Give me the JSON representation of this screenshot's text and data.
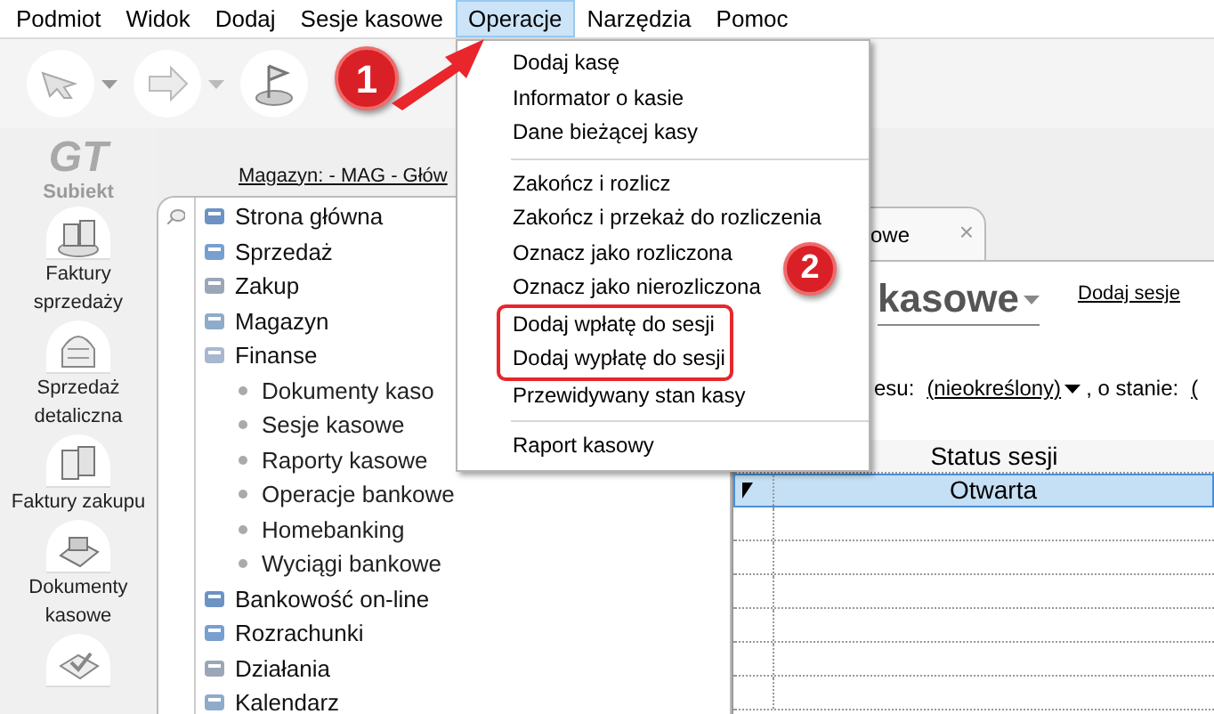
{
  "menu_bar": [
    {
      "label": "Podmiot",
      "selected": false
    },
    {
      "label": "Widok",
      "selected": false
    },
    {
      "label": "Dodaj",
      "selected": false
    },
    {
      "label": "Sesje kasowe",
      "selected": false
    },
    {
      "label": "Operacje",
      "selected": true
    },
    {
      "label": "Narzędzia",
      "selected": false
    },
    {
      "label": "Pomoc",
      "selected": false
    }
  ],
  "logo": {
    "mark": "GT",
    "name": "Subiekt"
  },
  "sidebar": {
    "items": [
      {
        "label": "Faktury sprzedaży"
      },
      {
        "label": "Sprzedaż detaliczna"
      },
      {
        "label": "Faktury zakupu"
      },
      {
        "label": "Dokumenty kasowe",
        "kind": "labelled"
      },
      {
        "kind": "icon_only"
      }
    ]
  },
  "warehouse_link": "Magazyn: - MAG - Głów",
  "tree": [
    {
      "label": "Strona główna"
    },
    {
      "label": "Sprzedaż"
    },
    {
      "label": "Zakup"
    },
    {
      "label": "Magazyn"
    },
    {
      "label": "Finanse",
      "children": [
        {
          "label": "Dokumenty kaso"
        },
        {
          "label": "Sesje kasowe"
        },
        {
          "label": "Raporty kasowe"
        },
        {
          "label": "Operacje bankowe"
        },
        {
          "label": "Homebanking"
        },
        {
          "label": "Wyciągi bankowe"
        }
      ]
    },
    {
      "label": "Bankowość on-line"
    },
    {
      "label": "Rozrachunki"
    },
    {
      "label": "Działania"
    },
    {
      "label": "Kalendarz"
    }
  ],
  "tab": {
    "label": "owe",
    "close": "×"
  },
  "view": {
    "title": "kasowe",
    "add_link": "Dodaj sesje",
    "filter_label": "esu:",
    "filter_value": "(nieokreślony)",
    "state_label": ", o stanie:",
    "state_value": "("
  },
  "table": {
    "columns": [
      "Status sesji"
    ],
    "rows": [
      {
        "cells": [
          "Otwarta"
        ],
        "selected": true
      }
    ]
  },
  "dropdown_menu": {
    "groups": [
      [
        {
          "label": "Dodaj kasę",
          "highlighted": false
        },
        {
          "label": "Informator o kasie",
          "highlighted": false
        },
        {
          "label": "Dane bieżącej kasy",
          "highlighted": false
        }
      ],
      [
        {
          "label": "Zakończ i rozlicz",
          "highlighted": false
        },
        {
          "label": "Zakończ i przekaż do rozliczenia",
          "highlighted": false
        },
        {
          "label": "Oznacz jako rozliczona",
          "highlighted": false
        },
        {
          "label": "Oznacz jako nierozliczona",
          "highlighted": false
        },
        {
          "label": "Dodaj wpłatę do sesji",
          "highlighted": true
        },
        {
          "label": "Dodaj wypłatę do sesji",
          "highlighted": true
        },
        {
          "label": "Przewidywany stan kasy",
          "highlighted": false
        }
      ],
      [
        {
          "label": "Raport kasowy",
          "highlighted": false
        }
      ]
    ]
  },
  "annotations": [
    {
      "label": "1"
    },
    {
      "label": "2"
    }
  ]
}
